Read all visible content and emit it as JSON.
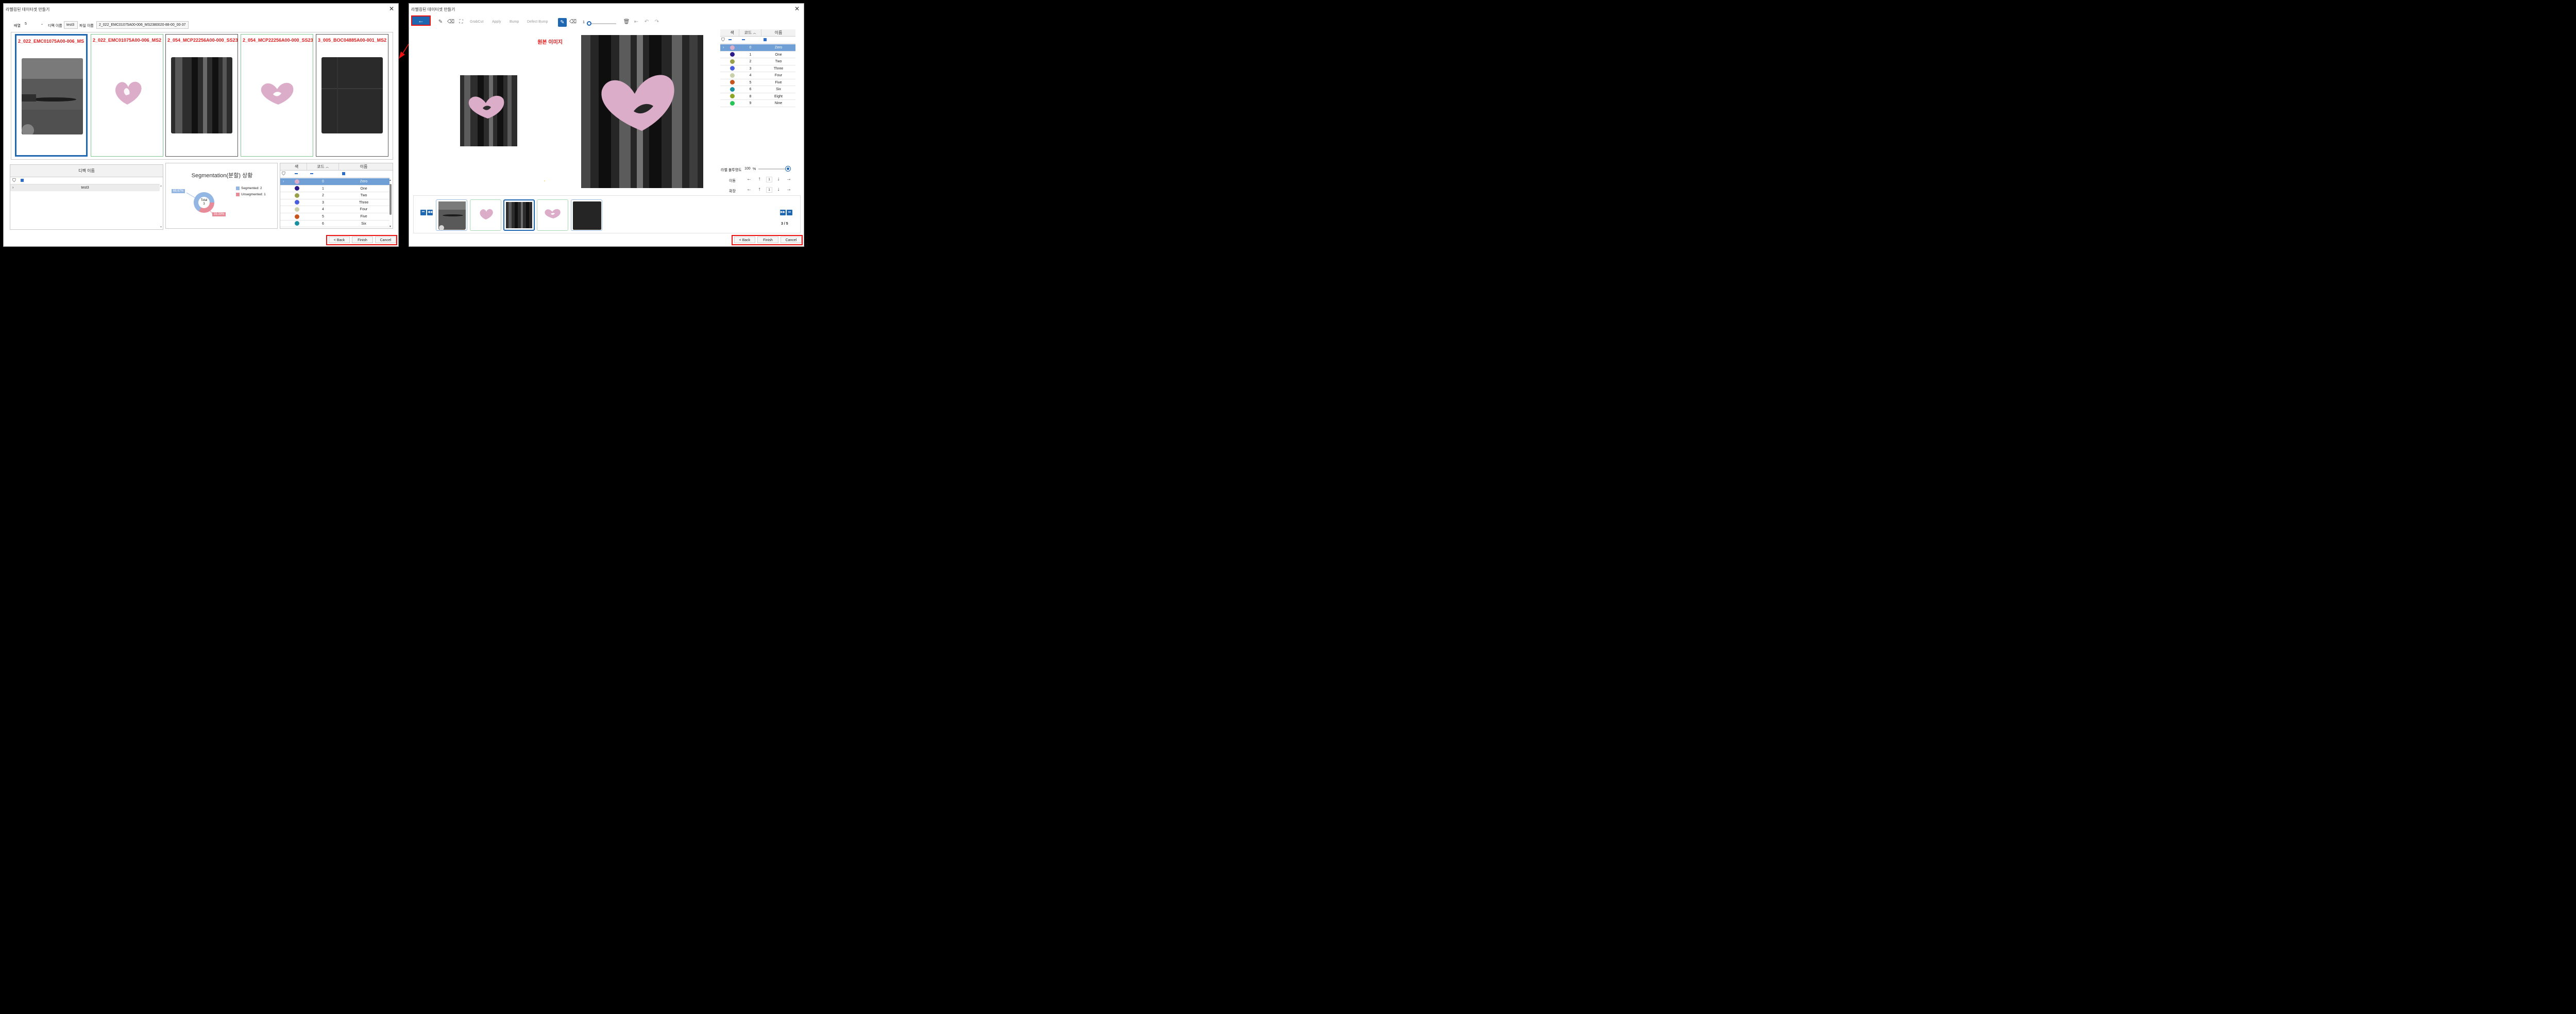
{
  "left": {
    "title": "라벨링된 데이터셋 만들기",
    "toolbar": {
      "array_label": "배열",
      "array_value": "5",
      "defect_label": "디펙 이름",
      "defect_value": "test3",
      "file_label": "파일 이름",
      "file_value": "2_022_EMC01075A00-006_MS2380020-88-00_00-37"
    },
    "cards": [
      {
        "name": "2_022_EMC01075A00-006_MS"
      },
      {
        "name": "2_022_EMC01075A00-006_MS2"
      },
      {
        "name": "2_054_MCP22256A00-000_SS23"
      },
      {
        "name": "2_054_MCP22256A00-000_SS23"
      },
      {
        "name": "3_005_BOC04885A00-001_MS2"
      }
    ],
    "defect_grid": {
      "header": "디펙 이름",
      "rows": [
        "test3"
      ]
    },
    "donut": {
      "title": "Segmentation(분할) 상황",
      "total_label": "Total",
      "total_value": "3",
      "segmented_pct": "66.67%",
      "unsegmented_pct": "33.33%",
      "legend_segmented": "Segmented: 2",
      "legend_unsegmented": "Unsegmented: 1",
      "color_segmented": "#93b6e3",
      "color_unsegmented": "#e88b99"
    },
    "buttons": {
      "back": "< Back",
      "finish": "Finish",
      "cancel": "Cancel"
    }
  },
  "right": {
    "title": "라벨링된 데이터셋 만들기",
    "toolbar": {
      "grabcut": "GrabCut",
      "apply": "Apply",
      "bump": "Bump",
      "defect_bump": "Defect Bump",
      "brush_size": "1"
    },
    "original_label": "원본 이미지",
    "opacity_label": "라벨 불투명도",
    "opacity_value": "100",
    "opacity_unit": "%",
    "move_label": "이동",
    "move_value": "1",
    "zoom_label": "확장",
    "zoom_value": "1",
    "page": "3 / 5",
    "buttons": {
      "back": "< Back",
      "finish": "Finish",
      "cancel": "Cancel"
    }
  },
  "label_table": {
    "headers": {
      "color": "색",
      "code": "코드",
      "name": "이름"
    },
    "rows": [
      {
        "code": "0",
        "name": "Zero",
        "color": "#dcadc9"
      },
      {
        "code": "1",
        "name": "One",
        "color": "#2a1a8a"
      },
      {
        "code": "2",
        "name": "Two",
        "color": "#9aa04a"
      },
      {
        "code": "3",
        "name": "Three",
        "color": "#4a5ee0"
      },
      {
        "code": "4",
        "name": "Four",
        "color": "#c9cfa8"
      },
      {
        "code": "5",
        "name": "Five",
        "color": "#c6541c"
      },
      {
        "code": "6",
        "name": "Six",
        "color": "#1a8fa0"
      },
      {
        "code": "8",
        "name": "Eight",
        "color": "#8aa624"
      },
      {
        "code": "9",
        "name": "Nine",
        "color": "#27c457"
      }
    ]
  }
}
